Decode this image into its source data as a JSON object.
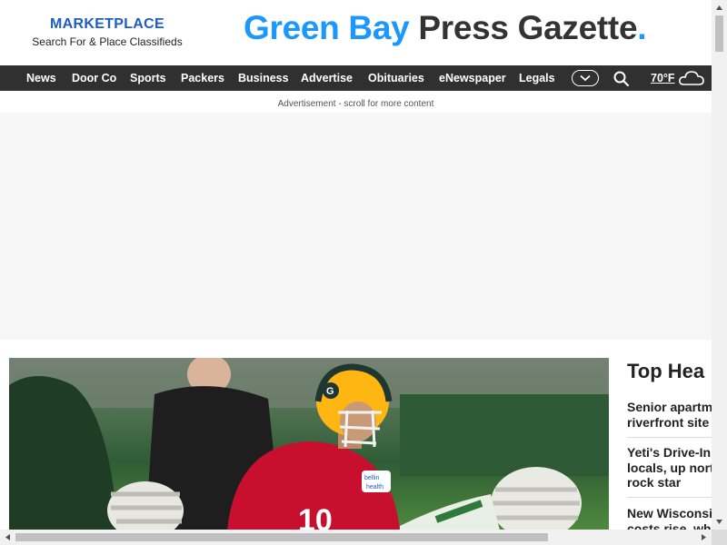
{
  "header": {
    "marketplace_title": "MARKETPLACE",
    "marketplace_subtitle": "Search For & Place Classifieds",
    "masthead_part1": "Green Bay",
    "masthead_part2": "Press Gazette",
    "masthead_dot": "."
  },
  "nav": {
    "items": [
      "News",
      "Door Co",
      "Sports",
      "Packers",
      "Business",
      "Advertise",
      "Obituaries",
      "eNewspaper",
      "Legals"
    ],
    "more_icon": "chevron-down-icon",
    "search_icon": "search-icon",
    "temperature": "70°F",
    "weather_icon": "cloud-icon"
  },
  "ad": {
    "label": "Advertisement - scroll for more content"
  },
  "top_headlines": {
    "title": "Top Hea",
    "items": [
      {
        "lines": [
          "Senior apartm",
          "riverfront site"
        ]
      },
      {
        "lines": [
          "Yeti's Drive-In",
          "locals, up nort",
          "rock star"
        ]
      },
      {
        "lines": [
          "New Wisconsi",
          "costs rise, wh"
        ]
      }
    ]
  },
  "hero": {
    "jersey_number": "10",
    "sponsor_patch": "bellin health"
  },
  "colors": {
    "brand_blue": "#1a98ff",
    "marketplace_blue": "#1e5bc6",
    "nav_bg": "#303030",
    "packers_green": "#203731",
    "packers_gold": "#ffb612"
  }
}
